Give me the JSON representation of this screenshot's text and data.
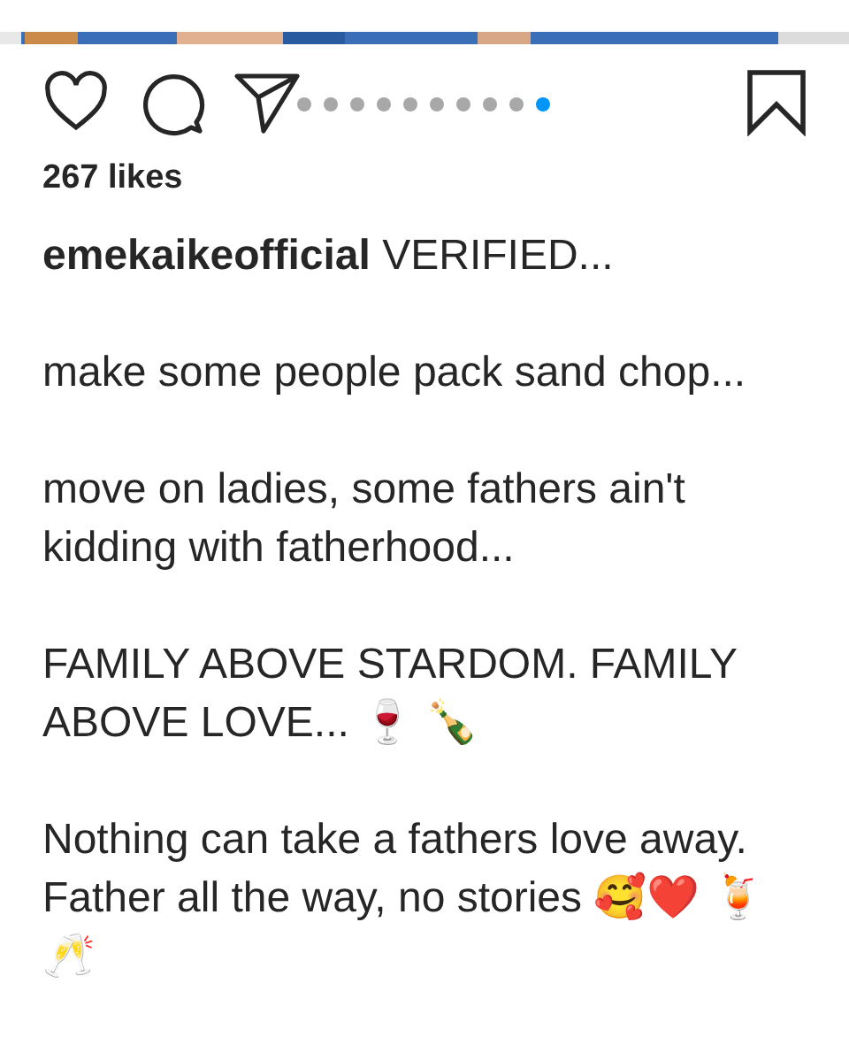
{
  "post": {
    "carousel": [
      {
        "selected": false
      },
      {
        "selected": false
      },
      {
        "selected": false
      },
      {
        "selected": false
      },
      {
        "selected": false
      },
      {
        "selected": false
      },
      {
        "selected": false
      },
      {
        "selected": false
      },
      {
        "selected": false
      },
      {
        "selected": true
      }
    ],
    "likes": "267 likes",
    "caption": [
      "**emekaikeofficial** VERIFIED...",
      "make some people pack sand chop...",
      "move on ladies, some fathers ain't kidding with fatherhood...",
      "FAMILY ABOVE STARDOM. FAMILY ABOVE LOVE... 🍷 🍾",
      "Nothing can take a fathers love away. Father all the way, no stories 🥰❤️ 🍹 🥂"
    ]
  }
}
